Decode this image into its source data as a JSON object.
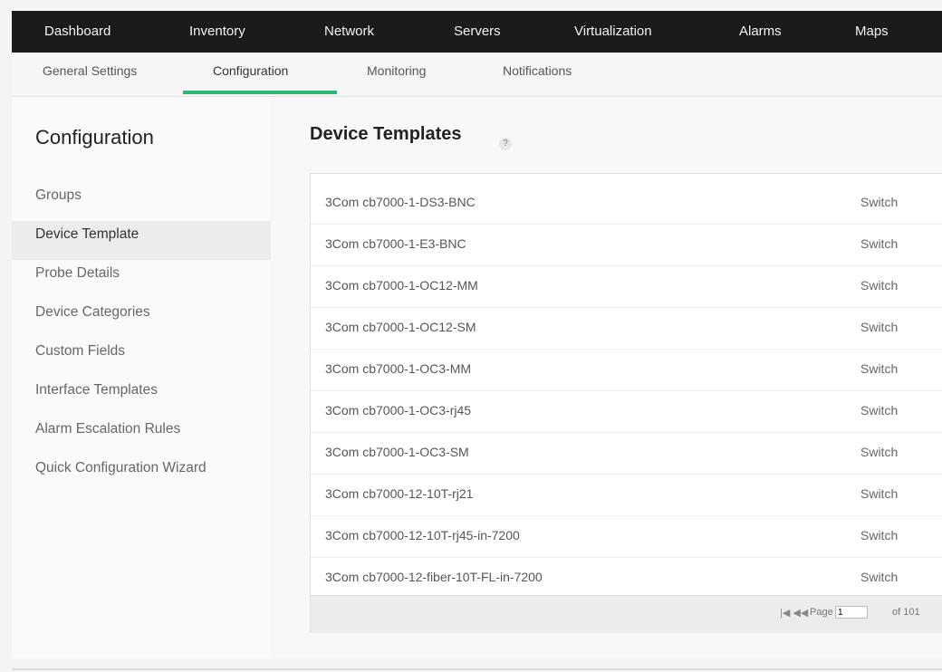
{
  "topnav": {
    "items": [
      "Dashboard",
      "Inventory",
      "Network",
      "Servers",
      "Virtualization",
      "Alarms",
      "Maps"
    ]
  },
  "subnav": {
    "tabs": [
      "General Settings",
      "Configuration",
      "Monitoring",
      "Notifications"
    ],
    "active_tab": "Configuration"
  },
  "sidebar": {
    "title": "Configuration",
    "items": [
      "Groups",
      "Device Template",
      "Probe Details",
      "Device Categories",
      "Custom Fields",
      "Interface Templates",
      "Alarm Escalation Rules",
      "Quick Configuration Wizard"
    ],
    "active_item": "Device Template"
  },
  "main": {
    "title": "Device Templates",
    "help_icon": "?",
    "rows": [
      {
        "name": "3Com cb7000-1-DS3-BNC",
        "type": "Switch"
      },
      {
        "name": "3Com cb7000-1-E3-BNC",
        "type": "Switch"
      },
      {
        "name": "3Com cb7000-1-OC12-MM",
        "type": "Switch"
      },
      {
        "name": "3Com cb7000-1-OC12-SM",
        "type": "Switch"
      },
      {
        "name": "3Com cb7000-1-OC3-MM",
        "type": "Switch"
      },
      {
        "name": "3Com cb7000-1-OC3-rj45",
        "type": "Switch"
      },
      {
        "name": "3Com cb7000-1-OC3-SM",
        "type": "Switch"
      },
      {
        "name": "3Com cb7000-12-10T-rj21",
        "type": "Switch"
      },
      {
        "name": "3Com cb7000-12-10T-rj45-in-7200",
        "type": "Switch"
      },
      {
        "name": "3Com cb7000-12-fiber-10T-FL-in-7200",
        "type": "Switch"
      }
    ],
    "pager": {
      "first_prev": "|◀ ◀◀",
      "page_label": "Page",
      "page_value": "1",
      "total": "of 101"
    }
  },
  "colors": {
    "topnav_bg": "#1b1b1b",
    "accent": "#2bb673",
    "active_item_bg": "#ececec"
  }
}
